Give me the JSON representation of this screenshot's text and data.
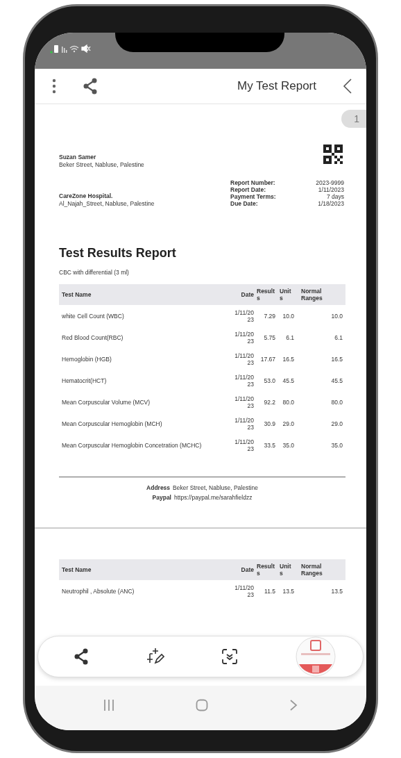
{
  "app_bar": {
    "title": "My Test Report"
  },
  "page_badge": "1",
  "patient": {
    "name": "Suzan Samer",
    "address": "Beker Street, Nabluse, Palestine"
  },
  "hospital": {
    "name": "CareZone Hospital.",
    "address": "Al_Najah_Street, Nabluse, Palestine"
  },
  "report_info": [
    {
      "label": "Report Number:",
      "value": "2023-9999"
    },
    {
      "label": "Report Date:",
      "value": "1/11/2023"
    },
    {
      "label": "Payment Terms:",
      "value": "7 days"
    },
    {
      "label": "Due Date:",
      "value": "1/18/2023"
    }
  ],
  "report": {
    "title": "Test Results Report",
    "subtitle": "CBC with differential (3 ml)"
  },
  "columns": [
    "Test Name",
    "Date",
    "Results",
    "Units",
    "Normal Ranges"
  ],
  "rows": [
    {
      "name": "white Cell Count (WBC)",
      "date": "1/11/2023",
      "result": "7.29",
      "units": "10.0",
      "normal_range": "10.0"
    },
    {
      "name": "Red Blood Count(RBC)",
      "date": "1/11/2023",
      "result": "5.75",
      "units": "6.1",
      "normal_range": "6.1"
    },
    {
      "name": "Hemoglobin (HGB)",
      "date": "1/11/2023",
      "result": "17.67",
      "units": "16.5",
      "normal_range": "16.5"
    },
    {
      "name": "Hematocrit(HCT)",
      "date": "1/11/2023",
      "result": "53.0",
      "units": "45.5",
      "normal_range": "45.5"
    },
    {
      "name": "Mean Corpuscular Volume (MCV)",
      "date": "1/11/2023",
      "result": "92.2",
      "units": "80.0",
      "normal_range": "80.0"
    },
    {
      "name": "Mean Corpuscular Hemoglobin (MCH)",
      "date": "1/11/2023",
      "result": "30.9",
      "units": "29.0",
      "normal_range": "29.0"
    },
    {
      "name": "Mean Corpuscular Hemoglobin Concetration (MCHC)",
      "date": "1/11/2023",
      "result": "33.5",
      "units": "35.0",
      "normal_range": "35.0"
    }
  ],
  "footer": [
    {
      "label": "Address",
      "value": "Beker Street, Nabluse, Palestine"
    },
    {
      "label": "Paypal",
      "value": "https://paypal.me/sarahfieldzz"
    }
  ],
  "page_2": {
    "columns": [
      "Test Name",
      "Date",
      "Results",
      "Units",
      "Normal Ranges"
    ],
    "rows": [
      {
        "name": "Neutrophil , Absolute (ANC)",
        "date": "1/11/2023",
        "result": "11.5",
        "units": "13.5",
        "normal_range": "13.5"
      }
    ]
  }
}
